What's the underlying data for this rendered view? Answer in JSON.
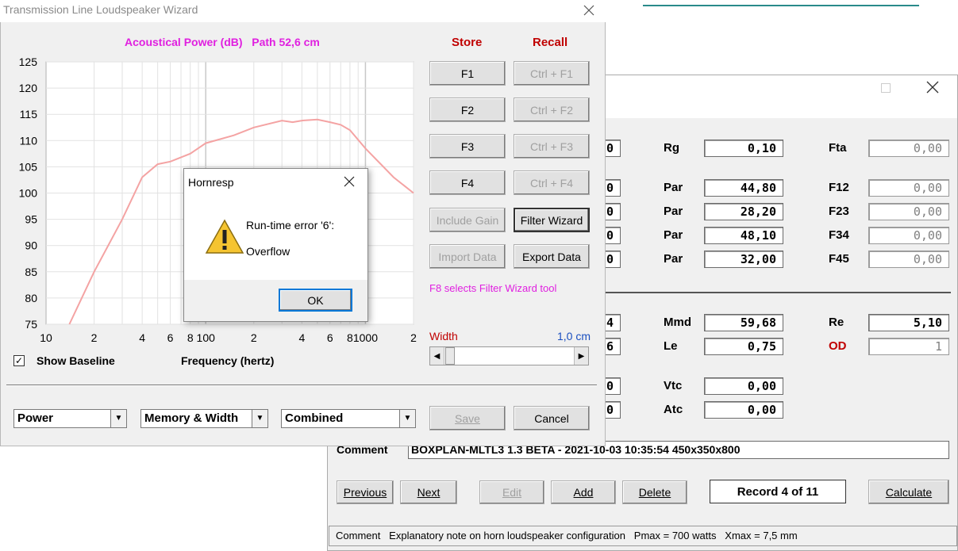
{
  "bg_window": {
    "title_bar": {
      "min_icon": "minimize-icon",
      "max_icon": "maximize-icon",
      "close_icon": "close-icon"
    },
    "fields_left_partial": [
      "0",
      "0",
      "0",
      "0",
      "0",
      "4",
      "6",
      "0",
      "0"
    ],
    "rows": [
      {
        "l1": "Rg",
        "v1": "0,10",
        "l2": "Fta",
        "v2": "0,00"
      },
      {
        "l1": "Par",
        "v1": "44,80",
        "l2": "F12",
        "v2": "0,00"
      },
      {
        "l1": "Par",
        "v1": "28,20",
        "l2": "F23",
        "v2": "0,00"
      },
      {
        "l1": "Par",
        "v1": "48,10",
        "l2": "F34",
        "v2": "0,00"
      },
      {
        "l1": "Par",
        "v1": "32,00",
        "l2": "F45",
        "v2": "0,00"
      },
      {
        "l1": "Mmd",
        "v1": "59,68",
        "l2": "Re",
        "v2": "5,10"
      },
      {
        "l1": "Le",
        "v1": "0,75",
        "l2": "OD",
        "v2": "1"
      },
      {
        "l1": "Vtc",
        "v1": "0,00"
      },
      {
        "l1": "Atc",
        "v1": "0,00"
      }
    ],
    "comment_label": "Comment",
    "comment_value": "BOXPLAN-MLTL3 1.3 BETA - 2021-10-03 10:35:54 450x350x800",
    "buttons": {
      "previous": "Previous",
      "next": "Next",
      "edit": "Edit",
      "add": "Add",
      "delete": "Delete",
      "calculate": "Calculate"
    },
    "record": "Record 4 of 11",
    "status": "Comment   Explanatory note on horn loudspeaker configuration   Pmax = 700 watts   Xmax = 7,5 mm"
  },
  "wizard": {
    "title": "Transmission Line Loudspeaker Wizard",
    "chart_heading": "Acoustical Power (dB)   Path 52,6 cm",
    "store_label": "Store",
    "recall_label": "Recall",
    "store_buttons": [
      "F1",
      "F2",
      "F3",
      "F4"
    ],
    "recall_buttons": [
      "Ctrl + F1",
      "Ctrl + F2",
      "Ctrl + F3",
      "Ctrl + F4"
    ],
    "include_gain": "Include Gain",
    "filter_wizard": "Filter Wizard",
    "import_data": "Import Data",
    "export_data": "Export Data",
    "f8_hint": "F8 selects Filter Wizard tool",
    "width_label": "Width",
    "width_value": "1,0 cm",
    "show_baseline": "Show Baseline",
    "freq_label": "Frequency (hertz)",
    "combo_power": "Power",
    "combo_memory": "Memory & Width",
    "combo_combined": "Combined",
    "save": "Save",
    "cancel": "Cancel"
  },
  "dialog": {
    "title": "Hornresp",
    "line1": "Run-time error '6':",
    "line2": "Overflow",
    "ok": "OK"
  },
  "chart_data": {
    "type": "line",
    "title": "Acoustical Power (dB)   Path 52,6 cm",
    "xlabel": "Frequency (hertz)",
    "ylabel": "",
    "xscale": "log",
    "xlim": [
      10,
      2000
    ],
    "ylim": [
      75,
      125
    ],
    "yticks": [
      75,
      80,
      85,
      90,
      95,
      100,
      105,
      110,
      115,
      120,
      125
    ],
    "xtick_labels": [
      "10",
      "2",
      "4",
      "6",
      "8",
      "100",
      "2",
      "4",
      "6",
      "8",
      "1000",
      "2"
    ],
    "grid": true,
    "color": "#f4a3a3",
    "x": [
      14,
      20,
      30,
      40,
      50,
      60,
      80,
      100,
      150,
      200,
      300,
      350,
      400,
      500,
      600,
      700,
      800,
      1000,
      1500,
      2000
    ],
    "y": [
      75,
      85,
      95,
      103,
      105.5,
      106,
      107.5,
      109.5,
      111,
      112.5,
      113.8,
      113.5,
      113.8,
      114,
      113.5,
      113,
      112,
      108.5,
      103,
      100
    ]
  }
}
